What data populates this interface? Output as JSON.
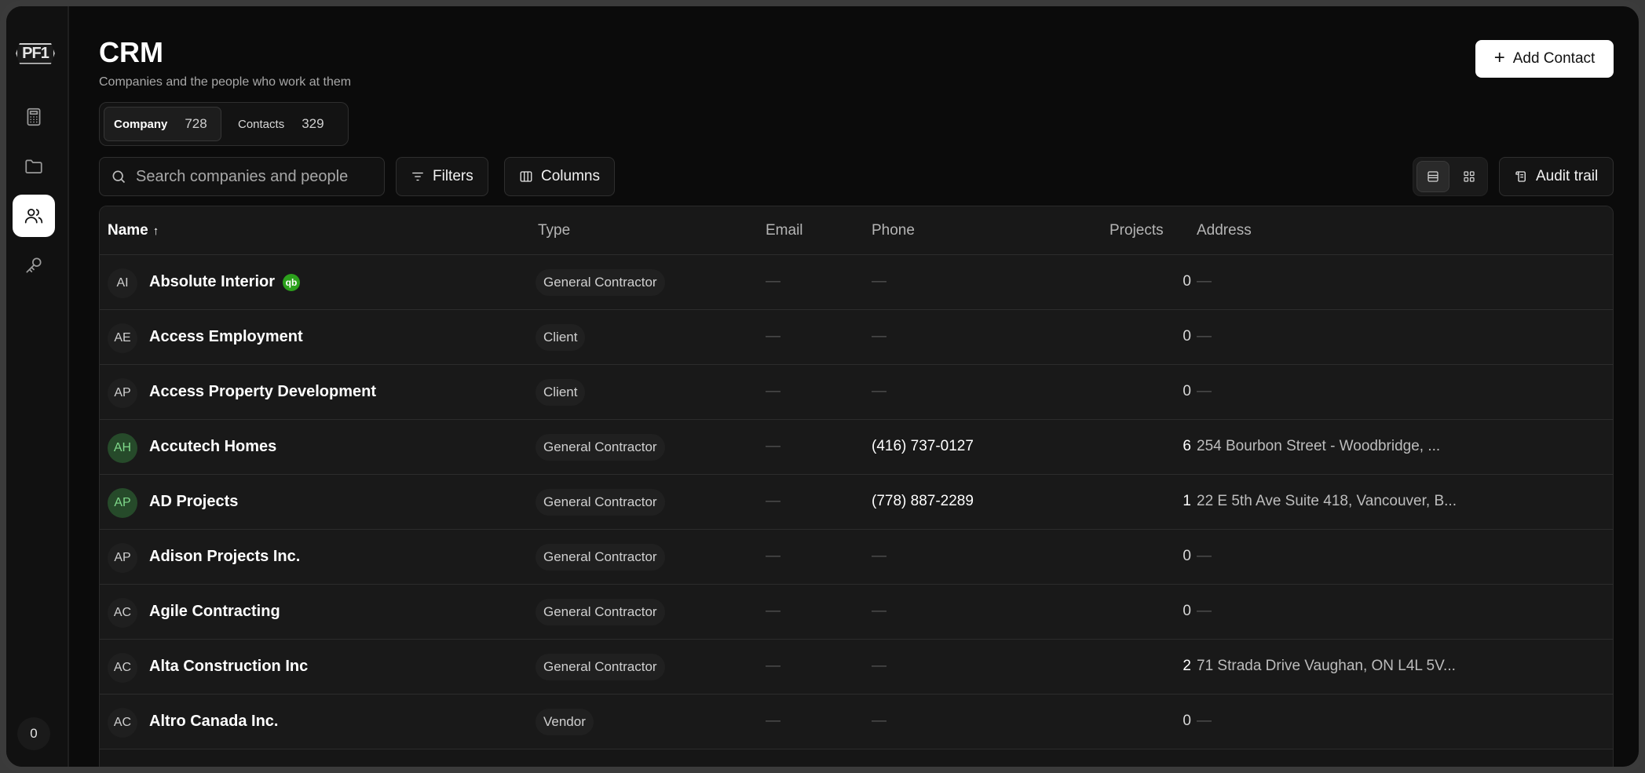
{
  "app": {
    "logo_text": "PF1",
    "counter": "0"
  },
  "header": {
    "title": "CRM",
    "subtitle": "Companies and the people who work at them",
    "add_button": "Add Contact"
  },
  "tabs": [
    {
      "label": "Company",
      "count": "728",
      "active": true
    },
    {
      "label": "Contacts",
      "count": "329",
      "active": false
    }
  ],
  "toolbar": {
    "search_placeholder": "Search companies and people",
    "filters_label": "Filters",
    "columns_label": "Columns",
    "audit_label": "Audit trail"
  },
  "table": {
    "columns": {
      "name": "Name",
      "type": "Type",
      "email": "Email",
      "phone": "Phone",
      "projects": "Projects",
      "address": "Address"
    },
    "rows": [
      {
        "initials": "AI",
        "name": "Absolute Interior",
        "type": "General Contractor",
        "email": "—",
        "phone": "—",
        "projects": "0",
        "address": "—",
        "qb": true
      },
      {
        "initials": "AE",
        "name": "Access Employment",
        "type": "Client",
        "email": "—",
        "phone": "—",
        "projects": "0",
        "address": "—"
      },
      {
        "initials": "AP",
        "name": "Access Property Development",
        "type": "Client",
        "email": "—",
        "phone": "—",
        "projects": "0",
        "address": "—"
      },
      {
        "initials": "AH",
        "name": "Accutech Homes",
        "type": "General Contractor",
        "email": "—",
        "phone": "(416) 737-0127",
        "projects": "6",
        "address": "254 Bourbon Street - Woodbridge, ...",
        "highlight": true
      },
      {
        "initials": "AP",
        "name": "AD Projects",
        "type": "General Contractor",
        "email": "—",
        "phone": "(778) 887-2289",
        "projects": "1",
        "address": "22 E 5th Ave Suite 418, Vancouver, B...",
        "highlight": true
      },
      {
        "initials": "AP",
        "name": "Adison Projects Inc.",
        "type": "General Contractor",
        "email": "—",
        "phone": "—",
        "projects": "0",
        "address": "—"
      },
      {
        "initials": "AC",
        "name": "Agile Contracting",
        "type": "General Contractor",
        "email": "—",
        "phone": "—",
        "projects": "0",
        "address": "—"
      },
      {
        "initials": "AC",
        "name": "Alta Construction Inc",
        "type": "General Contractor",
        "email": "—",
        "phone": "—",
        "projects": "2",
        "address": "71 Strada Drive Vaughan, ON L4L 5V..."
      },
      {
        "initials": "AC",
        "name": "Altro Canada Inc.",
        "type": "Vendor",
        "email": "—",
        "phone": "—",
        "projects": "0",
        "address": "—"
      }
    ]
  },
  "colors": {
    "accent_green": "#2ca01c",
    "avatar_green": "#7fd88a",
    "background": "#0b0b0b"
  },
  "icons": {
    "nav": [
      "calculator-icon",
      "folder-icon",
      "users-icon",
      "key-icon"
    ],
    "quickbooks_badge": "qb"
  }
}
